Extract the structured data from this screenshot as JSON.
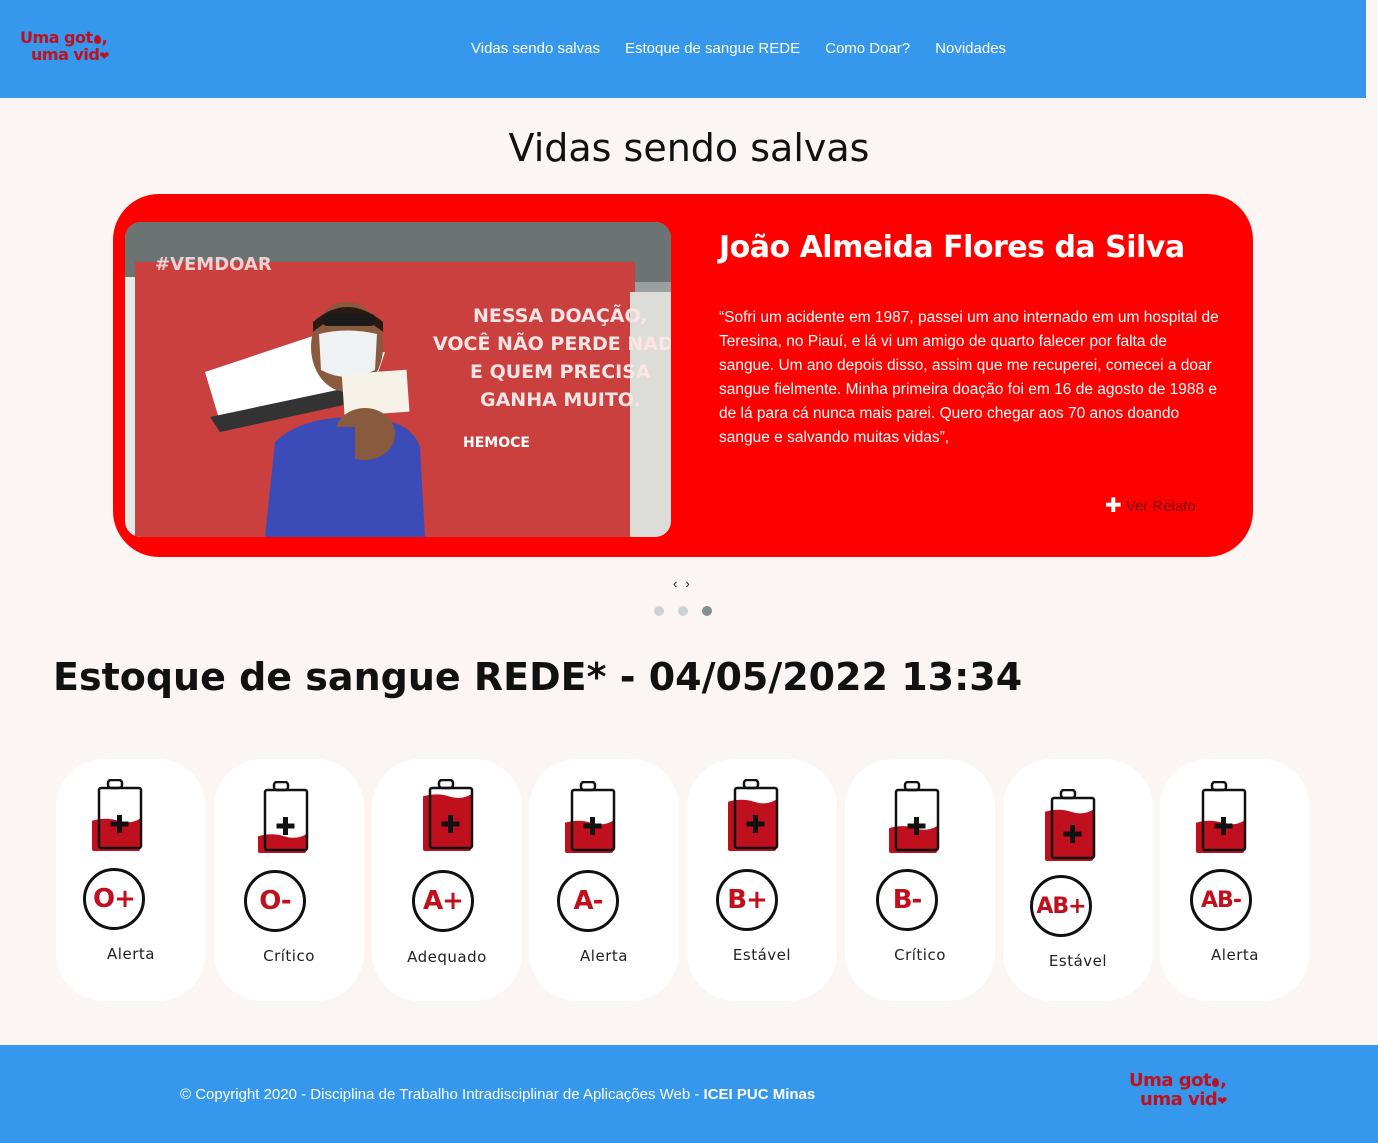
{
  "header": {
    "logo": {
      "line1": "Uma got",
      "line1_end": ",",
      "line2": "uma vid"
    },
    "nav": [
      "Vidas sendo salvas",
      "Estoque de sangue REDE",
      "Como Doar?",
      "Novidades"
    ]
  },
  "testimonials": {
    "title": "Vidas sendo salvas",
    "card": {
      "name": "João Almeida Flores da Silva",
      "quote": "“Sofri um acidente em 1987, passei um ano internado em um hospital de Teresina, no Piauí, e lá vi um amigo de quarto falecer por falta de sangue. Um ano depois disso, assim que me recuperei, comecei a doar sangue fielmente. Minha primeira doação foi em 16 de agosto de 1988 e de lá para cá nunca mais parei. Quero chegar aos 70 anos doando sangue e salvando muitas vidas”,",
      "more_label": "Ver Relato",
      "photo": {
        "wall_tag": "#VEMDOAR",
        "wall_lines": [
          "NESSA DOAÇÃO,",
          "VOCÊ NÃO PERDE NADA.",
          "E QUEM PRECISA",
          "GANHA MUITO."
        ],
        "brand": "HEMOCE"
      }
    },
    "prev_label": "‹",
    "next_label": "›",
    "slides": 3,
    "active_slide": 3
  },
  "stock": {
    "title": "Estoque de sangue REDE* - 04/05/2022 13:34",
    "items": [
      {
        "type": "O+",
        "status": "Alerta",
        "level": 0.45
      },
      {
        "type": "O-",
        "status": "Crítico",
        "level": 0.2
      },
      {
        "type": "A+",
        "status": "Adequado",
        "level": 0.9
      },
      {
        "type": "A-",
        "status": "Alerta",
        "level": 0.45
      },
      {
        "type": "B+",
        "status": "Estável",
        "level": 0.8
      },
      {
        "type": "B-",
        "status": "Crítico",
        "level": 0.35
      },
      {
        "type": "AB+",
        "status": "Estável",
        "level": 0.8
      },
      {
        "type": "AB-",
        "status": "Alerta",
        "level": 0.45
      }
    ]
  },
  "footer": {
    "copyright": "© Copyright 2020 - Disciplina de Trabalho Intradisciplinar de Aplicações Web - ",
    "org": "ICEI PUC Minas"
  },
  "colors": {
    "header_bg": "#3598ed",
    "card_bg": "#ff0000",
    "blood_red": "#c0101e",
    "page_bg": "#fbf6f3"
  }
}
